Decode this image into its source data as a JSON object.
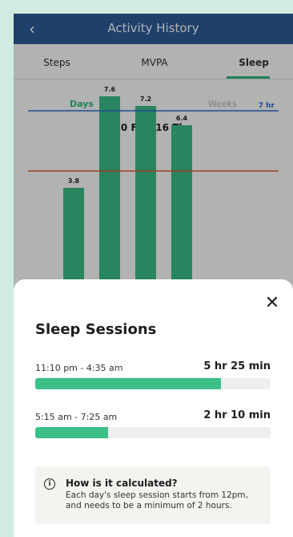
{
  "header": {
    "title": "Activity History",
    "back_icon": "chevron-left-icon",
    "background": "#2b5c9a"
  },
  "tabs": [
    {
      "label": "Steps",
      "selected": false
    },
    {
      "label": "MVPA",
      "selected": false
    },
    {
      "label": "Sleep",
      "selected": true
    }
  ],
  "range_toggle": {
    "days_label": "Days",
    "weeks_label": "Weeks",
    "selected": "Days"
  },
  "date_range": "10 Fri  -  16 Thu",
  "chart_data": {
    "type": "bar",
    "values": [
      3.8,
      7.6,
      7.2,
      6.4
    ],
    "value_labels": [
      "3.8",
      "7.6",
      "7.2",
      "6.4"
    ],
    "ylim": [
      0,
      10
    ],
    "reference_lines": [
      {
        "value": 7,
        "label": "7 hr",
        "color": "#2f6fcf"
      },
      {
        "value": 4.5,
        "label": "",
        "color": "#e0632c"
      }
    ],
    "bar_color": "#3cbf88"
  },
  "sheet": {
    "title": "Sleep Sessions",
    "close_icon": "close-icon",
    "sessions": [
      {
        "time": "11:10 pm - 4:35 am",
        "duration": "5 hr 25 min",
        "fraction": 0.79
      },
      {
        "time": "5:15 am - 7:25 am",
        "duration": "2 hr 10 min",
        "fraction": 0.31
      }
    ],
    "info": {
      "icon": "info-icon",
      "title": "How is it calculated?",
      "body": "Each day's sleep session starts from 12pm, and needs to be a minimum of 2 hours."
    }
  },
  "colors": {
    "accent": "#2fb97f",
    "bar": "#3cbf88",
    "page_background": "#d2ebe2"
  }
}
